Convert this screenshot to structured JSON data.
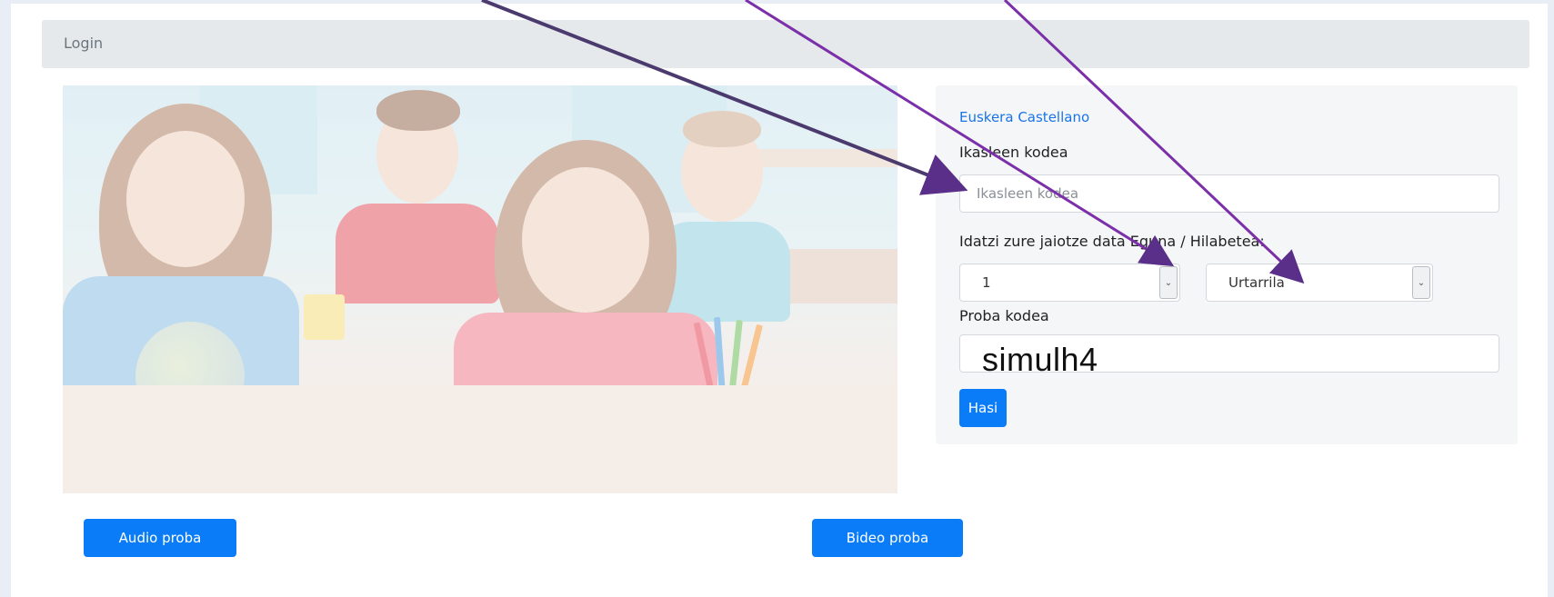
{
  "breadcrumb": {
    "label": "Login"
  },
  "hero": {
    "alt": "students-in-classroom"
  },
  "language": {
    "euskera": "Euskera",
    "castellano": "Castellano"
  },
  "form": {
    "student_code_label": "Ikasleen kodea",
    "student_code_placeholder": "Ikasleen kodea",
    "birth_label": "Idatzi zure jaiotze data Eguna / Hilabetea:",
    "day_value": "1",
    "month_value": "Urtarrila",
    "test_code_label": "Proba kodea",
    "test_code_value": "simulh4",
    "start_button": "Hasi"
  },
  "bottom": {
    "audio_button": "Audio proba",
    "video_button": "Bideo proba"
  },
  "colors": {
    "accent": "#0b7cf7",
    "link": "#1a73e8",
    "arrow": "#6a2fa0"
  }
}
